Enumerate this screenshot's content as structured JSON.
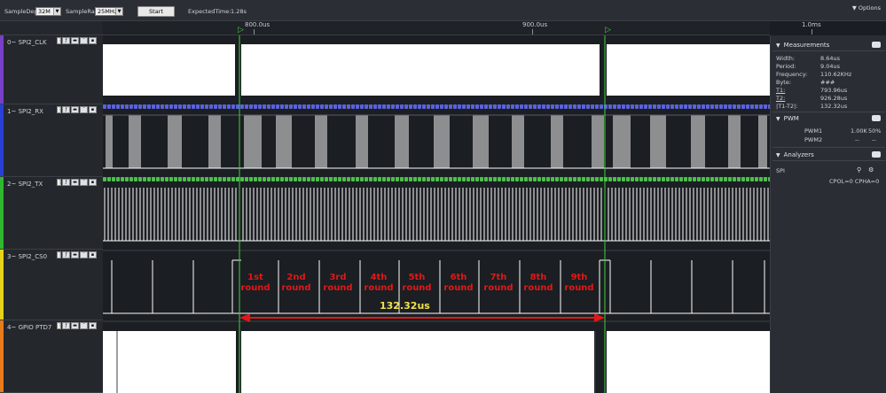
{
  "toolbar": {
    "sample_depth_label": "SampleDepth",
    "sample_depth_value": "32M",
    "sample_rate_label": "SampleRate",
    "sample_rate_value": "25MHz",
    "start_label": "Start",
    "expected_time_label": "ExpectedTime:",
    "expected_time_value": "1.28s",
    "options_label": "Options"
  },
  "ruler": {
    "ticks": [
      "800.0us",
      "900.0us",
      "1.0ms"
    ]
  },
  "channels": [
    {
      "index": "0",
      "name": "SPI2_CLK",
      "color": "#7a3fc8"
    },
    {
      "index": "1",
      "name": "SPI2_RX",
      "color": "#2a3fd8"
    },
    {
      "index": "2",
      "name": "SPI2_TX",
      "color": "#2fb82f"
    },
    {
      "index": "3",
      "name": "SPI2_CS0",
      "color": "#e6d21c"
    },
    {
      "index": "4",
      "name": "GPIO PTD7",
      "color": "#e87b1c"
    }
  ],
  "measurements": {
    "title": "Measurements",
    "rows": [
      {
        "label": "Width:",
        "value": "8.64us"
      },
      {
        "label": "Period:",
        "value": "9.04us"
      },
      {
        "label": "Frequency:",
        "value": "110.62KHz"
      },
      {
        "label": "Byte:",
        "value": "###"
      },
      {
        "label": "T1:",
        "value": "793.96us"
      },
      {
        "label": "T2:",
        "value": "926.28us"
      },
      {
        "label": "|T1-T2|:",
        "value": "132.32us"
      }
    ]
  },
  "pwm": {
    "title": "PWM",
    "rows": [
      {
        "label": "PWM1",
        "freq": "1.00K",
        "duty": "50%"
      },
      {
        "label": "PWM2",
        "freq": "--",
        "duty": "--"
      }
    ]
  },
  "analyzers": {
    "title": "Analyzers",
    "spi_label": "SPI",
    "spi_settings": "CPOL=0 CPHA=0"
  },
  "annotations": {
    "rounds": [
      {
        "top": "1st",
        "bottom": "round"
      },
      {
        "top": "2nd",
        "bottom": "round"
      },
      {
        "top": "3rd",
        "bottom": "round"
      },
      {
        "top": "4th",
        "bottom": "round"
      },
      {
        "top": "5th",
        "bottom": "round"
      },
      {
        "top": "6th",
        "bottom": "round"
      },
      {
        "top": "7th",
        "bottom": "round"
      },
      {
        "top": "8th",
        "bottom": "round"
      },
      {
        "top": "9th",
        "bottom": "round"
      }
    ],
    "duration": "132.32us"
  },
  "colors": {
    "cursor": "#3fd03f",
    "annotation_red": "#e01818",
    "annotation_yellow": "#f2e24a",
    "rx_bus": "#5a62e0",
    "tx_bus": "#4cc04c"
  }
}
